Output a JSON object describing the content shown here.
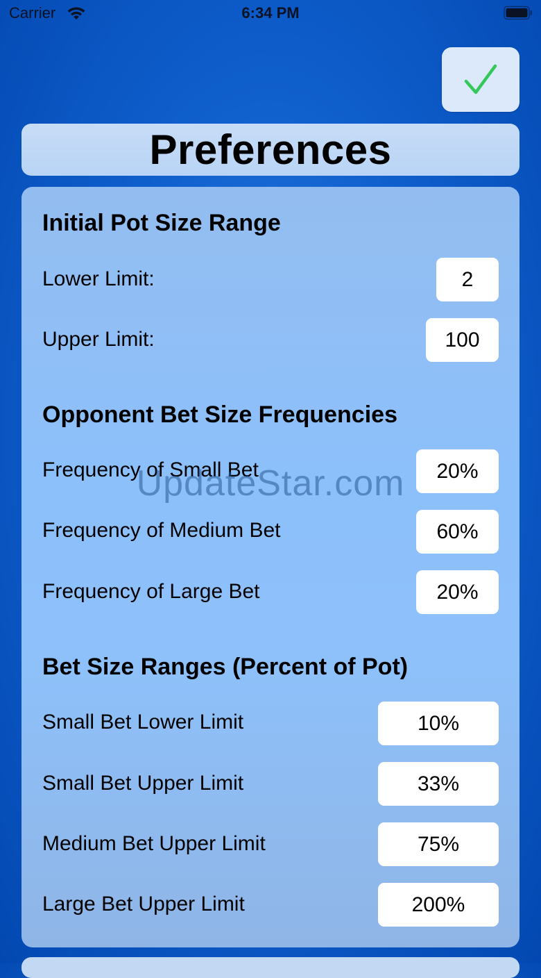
{
  "status_bar": {
    "carrier": "Carrier",
    "time": "6:34 PM"
  },
  "done_button": {
    "icon": "checkmark-icon",
    "color": "#34c759"
  },
  "title": "Preferences",
  "sections": {
    "pot": {
      "heading": "Initial Pot Size Range",
      "lower_label": "Lower Limit:",
      "lower_value": "2",
      "upper_label": "Upper Limit:",
      "upper_value": "100"
    },
    "frequencies": {
      "heading": "Opponent Bet Size Frequencies",
      "small_label": "Frequency of Small Bet",
      "small_value": "20%",
      "medium_label": "Frequency of Medium Bet",
      "medium_value": "60%",
      "large_label": "Frequency of Large Bet",
      "large_value": "20%"
    },
    "ranges": {
      "heading": "Bet Size Ranges (Percent of Pot)",
      "small_lower_label": "Small Bet Lower Limit",
      "small_lower_value": "10%",
      "small_upper_label": "Small Bet Upper Limit",
      "small_upper_value": "33%",
      "medium_upper_label": "Medium Bet Upper Limit",
      "medium_upper_value": "75%",
      "large_upper_label": "Large Bet Upper Limit",
      "large_upper_value": "200%"
    }
  },
  "watermark": "UpdateStar.com"
}
